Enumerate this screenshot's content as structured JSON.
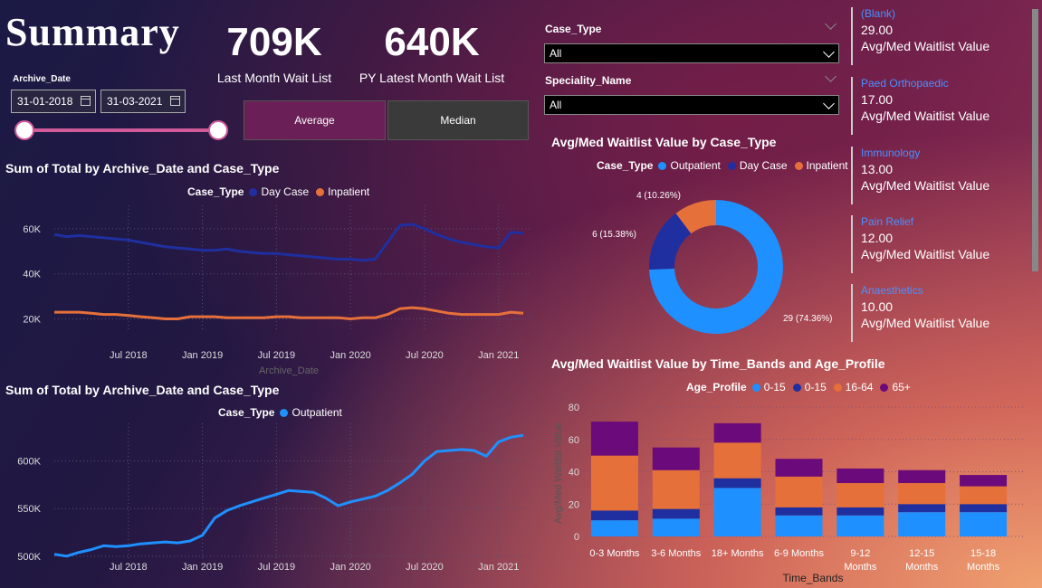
{
  "title": "Summary",
  "kpis": [
    {
      "value": "709K",
      "label": "Last Month Wait List"
    },
    {
      "value": "640K",
      "label": "PY Latest Month Wait List"
    }
  ],
  "archive_date": {
    "label": "Archive_Date",
    "start": "31-01-2018",
    "end": "31-03-2021"
  },
  "buttons": {
    "average": "Average",
    "median": "Median"
  },
  "slicers": {
    "case_type": {
      "label": "Case_Type",
      "value": "All"
    },
    "speciality": {
      "label": "Speciality_Name",
      "value": "All"
    }
  },
  "colors": {
    "day_case": "#1f2fa0",
    "inpatient": "#e6703a",
    "outpatient": "#1e90ff",
    "purple": "#6b0a7a",
    "card_accent": "#4a90ff",
    "button_active": "#6a1f56",
    "button_inactive": "#3a3a3a"
  },
  "cards": [
    {
      "category": "(Blank)",
      "value": "29.00",
      "label": "Avg/Med Waitlist Value"
    },
    {
      "category": "Paed Orthopaedic",
      "value": "17.00",
      "label": "Avg/Med Waitlist Value"
    },
    {
      "category": "Immunology",
      "value": "13.00",
      "label": "Avg/Med Waitlist Value"
    },
    {
      "category": "Pain Relief",
      "value": "12.00",
      "label": "Avg/Med Waitlist Value"
    },
    {
      "category": "Anaesthetics",
      "value": "10.00",
      "label": "Avg/Med Waitlist Value"
    }
  ],
  "chart_data": [
    {
      "type": "line",
      "title": "Sum of Total by Archive_Date and Case_Type",
      "xlabel": "Archive_Date",
      "legend_title": "Case_Type",
      "x_ticks": [
        "Jul 2018",
        "Jan 2019",
        "Jul 2019",
        "Jan 2020",
        "Jul 2020",
        "Jan 2021"
      ],
      "y_ticks": [
        "60K",
        "40K",
        "20K"
      ],
      "y_tick_values": [
        60000,
        40000,
        20000
      ],
      "ylim": [
        15000,
        68000
      ],
      "x": [
        "2018-01",
        "2018-02",
        "2018-03",
        "2018-04",
        "2018-05",
        "2018-06",
        "2018-07",
        "2018-08",
        "2018-09",
        "2018-10",
        "2018-11",
        "2018-12",
        "2019-01",
        "2019-02",
        "2019-03",
        "2019-04",
        "2019-05",
        "2019-06",
        "2019-07",
        "2019-08",
        "2019-09",
        "2019-10",
        "2019-11",
        "2019-12",
        "2020-01",
        "2020-02",
        "2020-03",
        "2020-04",
        "2020-05",
        "2020-06",
        "2020-07",
        "2020-08",
        "2020-09",
        "2020-10",
        "2020-11",
        "2020-12",
        "2021-01",
        "2021-02",
        "2021-03"
      ],
      "series": [
        {
          "name": "Day Case",
          "values": [
            57500,
            56500,
            57000,
            56500,
            56000,
            55500,
            55000,
            54000,
            53000,
            52000,
            51500,
            51000,
            50500,
            50500,
            51000,
            50000,
            49500,
            49000,
            49000,
            48500,
            48000,
            47500,
            47000,
            46500,
            46500,
            46000,
            46500,
            54000,
            61500,
            62000,
            60000,
            57500,
            55500,
            54000,
            53000,
            52000,
            51500,
            58500,
            58000
          ]
        },
        {
          "name": "Inpatient",
          "values": [
            23000,
            23000,
            23000,
            22500,
            22000,
            22000,
            21500,
            21000,
            20500,
            20000,
            20000,
            21000,
            21000,
            21000,
            20500,
            20500,
            20500,
            20500,
            21000,
            21000,
            20500,
            20500,
            20500,
            20500,
            20000,
            20500,
            20500,
            22000,
            24500,
            25000,
            24500,
            23500,
            22500,
            22000,
            22000,
            22000,
            22000,
            23000,
            22500
          ]
        }
      ]
    },
    {
      "type": "line",
      "title": "Sum of Total by Archive_Date and Case_Type",
      "legend_title": "Case_Type",
      "x_ticks": [
        "Jul 2018",
        "Jan 2019",
        "Jul 2019",
        "Jan 2020",
        "Jul 2020",
        "Jan 2021"
      ],
      "y_ticks": [
        "600K",
        "550K",
        "500K"
      ],
      "y_tick_values": [
        600000,
        550000,
        500000
      ],
      "ylim": [
        497000,
        630000
      ],
      "x": [
        "2018-01",
        "2018-02",
        "2018-03",
        "2018-04",
        "2018-05",
        "2018-06",
        "2018-07",
        "2018-08",
        "2018-09",
        "2018-10",
        "2018-11",
        "2018-12",
        "2019-01",
        "2019-02",
        "2019-03",
        "2019-04",
        "2019-05",
        "2019-06",
        "2019-07",
        "2019-08",
        "2019-09",
        "2019-10",
        "2019-11",
        "2019-12",
        "2020-01",
        "2020-02",
        "2020-03",
        "2020-04",
        "2020-05",
        "2020-06",
        "2020-07",
        "2020-08",
        "2020-09",
        "2020-10",
        "2020-11",
        "2020-12",
        "2021-01",
        "2021-02",
        "2021-03"
      ],
      "series": [
        {
          "name": "Outpatient",
          "values": [
            502000,
            500000,
            504000,
            507000,
            511000,
            510000,
            511000,
            513000,
            514000,
            515000,
            514000,
            516000,
            522000,
            540000,
            548000,
            553000,
            557000,
            561000,
            565000,
            569000,
            568000,
            567000,
            561000,
            553000,
            557000,
            560000,
            563000,
            569000,
            577000,
            586000,
            600000,
            610000,
            611000,
            612000,
            611000,
            605000,
            620000,
            625000,
            627000
          ]
        }
      ]
    },
    {
      "type": "pie",
      "title": "Avg/Med Waitlist Value by Case_Type",
      "legend_title": "Case_Type",
      "labels": [
        "Outpatient",
        "Day Case",
        "Inpatient"
      ],
      "values": [
        29,
        6,
        4
      ],
      "data_labels": [
        "29 (74.36%)",
        "6 (15.38%)",
        "4 (10.26%)"
      ]
    },
    {
      "type": "bar",
      "stacked": true,
      "title": "Avg/Med Waitlist Value by Time_Bands and Age_Profile",
      "xlabel": "Time_Bands",
      "ylabel": "Avg/Med Waitlist Value",
      "legend_title": "Age_Profile",
      "categories": [
        [
          "0-3 Months"
        ],
        [
          "3-6 Months"
        ],
        [
          "18+ Months"
        ],
        [
          "6-9 Months"
        ],
        [
          "9-12",
          "Months"
        ],
        [
          "12-15",
          "Months"
        ],
        [
          "15-18",
          "Months"
        ]
      ],
      "y_ticks": [
        0,
        20,
        40,
        60,
        80
      ],
      "ylim": [
        0,
        80
      ],
      "series": [
        {
          "name": "0-15",
          "values": [
            10,
            11,
            30,
            13,
            13,
            15,
            15
          ]
        },
        {
          "name": "0-15",
          "values": [
            6,
            6,
            6,
            5,
            5,
            5,
            5
          ]
        },
        {
          "name": "16-64",
          "values": [
            34,
            24,
            22,
            19,
            15,
            13,
            11
          ]
        },
        {
          "name": "65+",
          "values": [
            21,
            14,
            12,
            11,
            9,
            8,
            7
          ]
        }
      ]
    }
  ]
}
